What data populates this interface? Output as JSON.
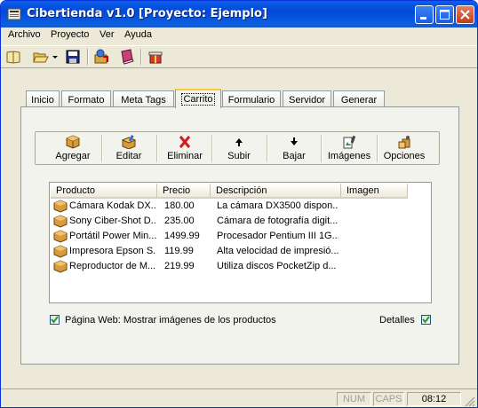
{
  "window": {
    "title": "Cibertienda v1.0 [Proyecto: Ejemplo]"
  },
  "menu": [
    "Archivo",
    "Proyecto",
    "Ver",
    "Ayuda"
  ],
  "toolbar_icons": [
    "open-book-icon",
    "open-folder-icon",
    "dropdown-arrow-icon",
    "save-disk-icon",
    "upload-publish-icon",
    "book-icon",
    "gift-icon"
  ],
  "tabs": [
    "Inicio",
    "Formato",
    "Meta Tags",
    "Carrito",
    "Formulario",
    "Servidor",
    "Generar"
  ],
  "active_tab": "Carrito",
  "actions": [
    "Agregar",
    "Editar",
    "Eliminar",
    "Subir",
    "Bajar",
    "Imágenes",
    "Opciones"
  ],
  "table": {
    "columns": [
      "Producto",
      "Precio",
      "Descripción",
      "Imagen"
    ],
    "rows": [
      {
        "producto": "Cámara Kodak DX...",
        "precio": "180.00",
        "descripcion": "La cámara DX3500 dispon..."
      },
      {
        "producto": "Sony Ciber-Shot D...",
        "precio": "235.00",
        "descripcion": "Cámara de fotografía digit..."
      },
      {
        "producto": "Portátil Power Min...",
        "precio": "1499.99",
        "descripcion": "Procesador Pentium III 1G..."
      },
      {
        "producto": "Impresora Epson S...",
        "precio": "119.99",
        "descripcion": "Alta velocidad de impresió..."
      },
      {
        "producto": "Reproductor de M...",
        "precio": "219.99",
        "descripcion": "Utiliza discos PocketZip d..."
      }
    ]
  },
  "options": {
    "show_images_label": "Página Web: Mostrar imágenes de los productos",
    "show_images_checked": true,
    "details_label": "Detalles",
    "details_checked": true
  },
  "status": {
    "num": "NUM",
    "caps": "CAPS",
    "time": "08:12"
  },
  "colors": {
    "title_bar": "#0348d8",
    "face": "#ece9d8",
    "active_tab_highlight": "#ffc83c",
    "delete_icon": "#d11a1a"
  }
}
